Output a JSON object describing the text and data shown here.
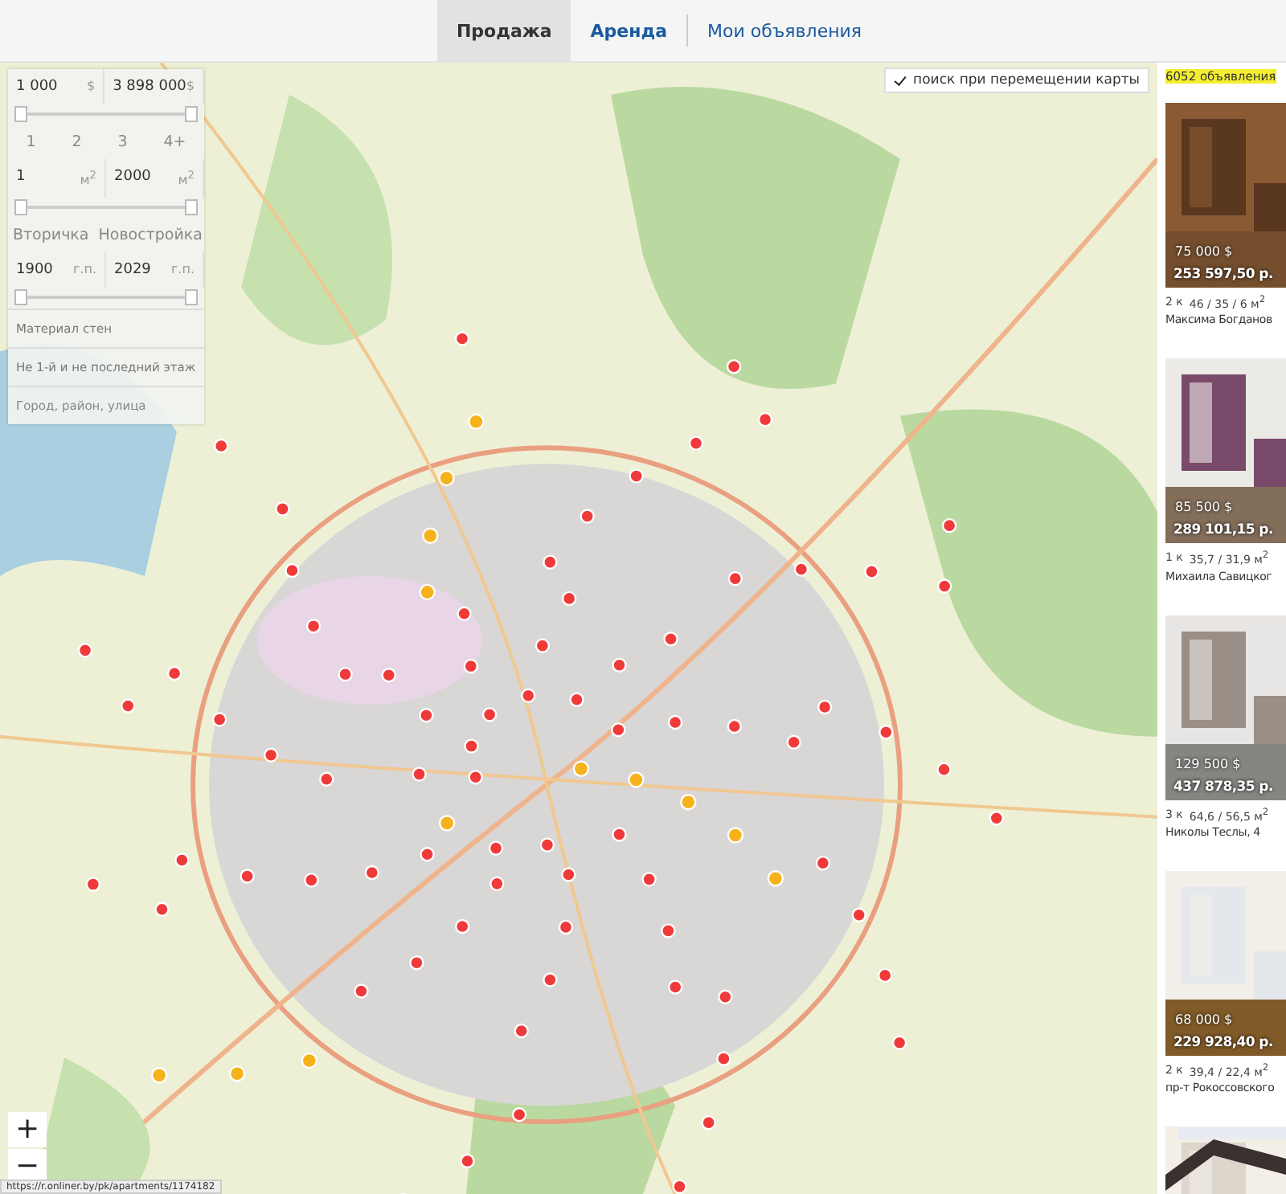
{
  "tabs": [
    {
      "label": "Продажа",
      "selected": true
    },
    {
      "label": "Аренда",
      "selected": false
    },
    {
      "label": "Мои объявления",
      "selected": false
    }
  ],
  "filters": {
    "price": {
      "from": "1 000",
      "from_unit": "$",
      "to": "3 898 000",
      "to_unit": "$",
      "thumbs": [
        {
          "level": 0
        },
        {
          "level": 1
        }
      ]
    },
    "rooms": [
      {
        "label": "1",
        "selected": false
      },
      {
        "label": "2",
        "selected": false
      },
      {
        "label": "3",
        "selected": false
      },
      {
        "label": "4+",
        "selected": false
      }
    ],
    "area": {
      "from": "1",
      "from_unit": "м$^{2}$",
      "to": "2000",
      "to_unit": "м$^{2}$",
      "thumbs": [
        {
          "level": 0
        },
        {
          "level": 1
        }
      ]
    },
    "building_type": [
      {
        "label": "Вторичка",
        "selected": false
      },
      {
        "label": "Новостройка",
        "selected": false
      }
    ],
    "year": {
      "from": "1900",
      "from_unit": "г.п.",
      "to": "2029",
      "to_unit": "г.п.",
      "thumbs": [
        {
          "level": 0
        },
        {
          "level": 1
        }
      ]
    },
    "wall_material": "Материал стен",
    "floor_option": "Не 1-й и не последний этаж",
    "address": {
      "placeholder": "Город, район, улица"
    }
  },
  "map": {
    "search_on_move": {
      "label": "поиск при перемещении карты",
      "checked": true
    },
    "zoom_in": "+",
    "zoom_out": "−",
    "status_url": "https://r.onliner.by/pk/apartments/1174182"
  },
  "listings_count": "6052 объявления",
  "listings": [
    {
      "usd": "75 000 $",
      "byn": "253 597,50 р.",
      "rooms": "2 к",
      "area": "46 / 35 / 6 м$^{2}$",
      "address": "Максима Богданов"
    },
    {
      "usd": "85 500 $",
      "byn": "289 101,15 р.",
      "rooms": "1 к",
      "area": "35,7 / 31,9 м$^{2}$",
      "address": "Михаила Савицког"
    },
    {
      "usd": "129 500 $",
      "byn": "437 878,35 р.",
      "rooms": "3 к",
      "area": "64,6 / 56,5 м$^{2}$",
      "address": "Николы Теслы, 4"
    },
    {
      "usd": "68 000 $",
      "byn": "229 928,40 р.",
      "rooms": "2 к",
      "area": "39,4 / 22,4 м$^{2}$",
      "address": "пр-т Рокоссовского"
    },
    {
      "kind": "picture"
    }
  ]
}
